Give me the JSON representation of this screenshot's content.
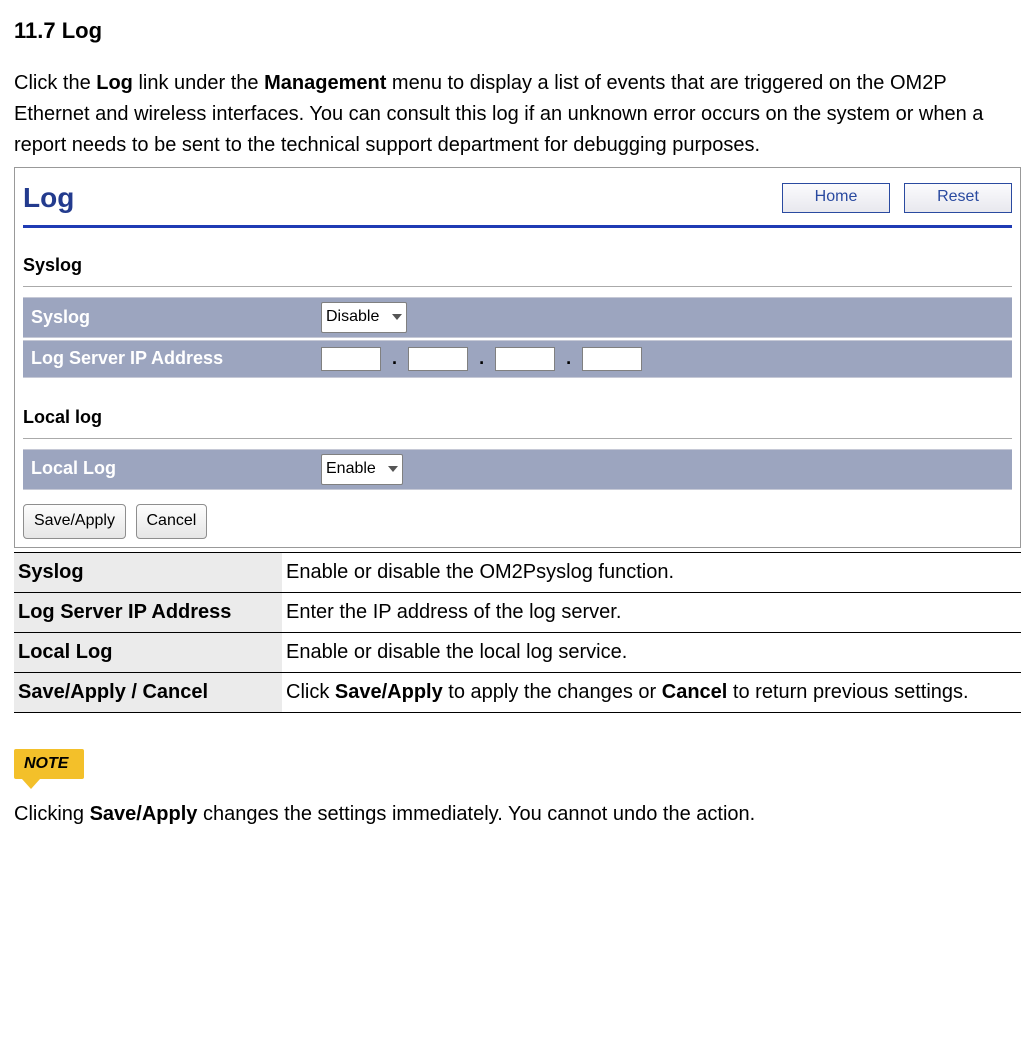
{
  "heading": "11.7 Log",
  "intro": {
    "p1a": "Click the ",
    "p1b": "Log",
    "p1c": " link under the ",
    "p1d": "Management",
    "p1e": " menu to display a list of events that are triggered on the OM2P Ethernet and wireless interfaces. You can consult this log if an unknown error occurs on the system or when a report needs to be sent to the technical support department for debugging purposes."
  },
  "panel": {
    "title": "Log",
    "buttons": {
      "home": "Home",
      "reset": "Reset"
    },
    "section_syslog_label": "Syslog",
    "rows": {
      "syslog_label": "Syslog",
      "syslog_value": "Disable",
      "ip_label": "Log Server IP Address",
      "ip": {
        "a": "",
        "b": "",
        "c": "",
        "d": ""
      },
      "section_locallog_label": "Local log",
      "locallog_label": "Local Log",
      "locallog_value": "Enable"
    },
    "actions": {
      "save": "Save/Apply",
      "cancel": "Cancel"
    }
  },
  "desc": {
    "rows": [
      {
        "k": "Syslog",
        "v": "Enable or disable the OM2Psyslog function."
      },
      {
        "k": "Log Server IP Address",
        "v": "Enter the IP address of the log server."
      },
      {
        "k": "Local Log",
        "v": "Enable or disable the local log service."
      }
    ],
    "save_row": {
      "k": "Save/Apply / Cancel",
      "v1": "Click ",
      "v2": "Save/Apply",
      "v3": " to apply the changes or ",
      "v4": "Cancel",
      "v5": " to return previous settings."
    }
  },
  "note": {
    "badge": "NOTE",
    "t1": "Clicking ",
    "t2": "Save/Apply",
    "t3": " changes the settings immediately. You cannot undo the action."
  },
  "dot": "."
}
